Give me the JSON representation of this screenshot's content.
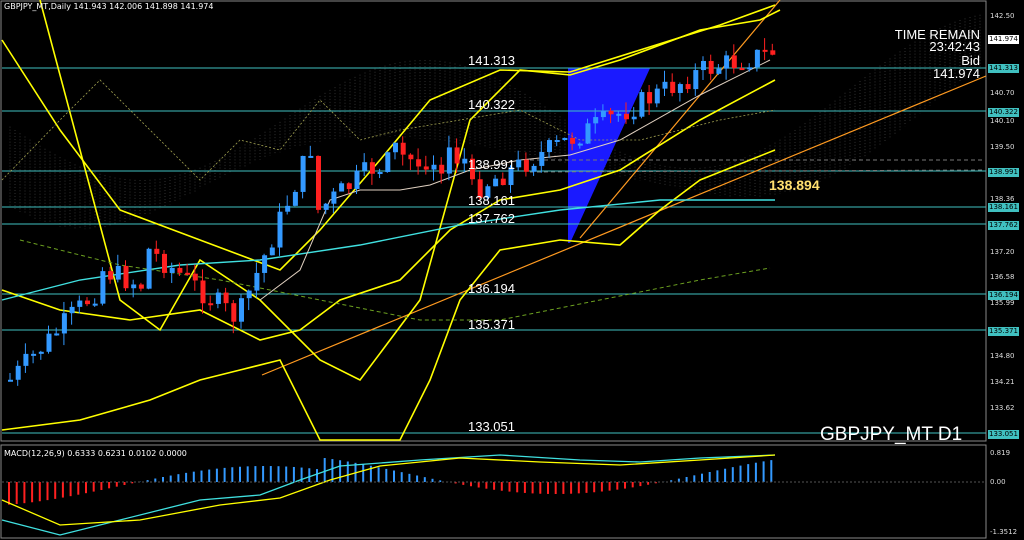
{
  "header": {
    "title": "GBPJPY_MT,Daily  141.943 142.006 141.898 141.974"
  },
  "info": {
    "time_remain_label": "TIME REMAIN",
    "time_remain_value": "23:42:43",
    "bid_label": "Bid",
    "bid_value": "141.974"
  },
  "symbol_label": "GBPJPY_MT D1",
  "level_labels": [
    "141.313",
    "140.322",
    "138.991",
    "138.161",
    "137.762",
    "136.194",
    "135.371",
    "133.051"
  ],
  "highlight_level": "138.894",
  "price_axis": {
    "ticks": [
      "142.50",
      "141.91",
      "140.70",
      "140.10",
      "139.50",
      "138.90",
      "138.36",
      "137.76",
      "137.20",
      "136.58",
      "135.99",
      "135.40",
      "134.80",
      "134.21",
      "133.62",
      "133.02"
    ],
    "boxes": [
      {
        "label": "141.974",
        "color": "#ffffff",
        "bg": "#ffffff",
        "fg": "#000000"
      },
      {
        "label": "141.313",
        "color": "#40c0c0",
        "bg": "#40c0c0",
        "fg": "#000000"
      },
      {
        "label": "140.322",
        "color": "#40c0c0",
        "bg": "#40c0c0",
        "fg": "#000000"
      },
      {
        "label": "138.991",
        "color": "#40c0c0",
        "bg": "#40c0c0",
        "fg": "#000000"
      },
      {
        "label": "138.161",
        "color": "#40c0c0",
        "bg": "#40c0c0",
        "fg": "#000000"
      },
      {
        "label": "137.762",
        "color": "#40c0c0",
        "bg": "#40c0c0",
        "fg": "#000000"
      },
      {
        "label": "136.194",
        "color": "#40c0c0",
        "bg": "#40c0c0",
        "fg": "#000000"
      },
      {
        "label": "135.371",
        "color": "#40c0c0",
        "bg": "#40c0c0",
        "fg": "#000000"
      },
      {
        "label": "133.051",
        "color": "#40c0c0",
        "bg": "#40c0c0",
        "fg": "#000000"
      }
    ]
  },
  "macd": {
    "header": "MACD(12,26,9)  0.6333  0.6231  0.0102  0.0000",
    "ticks": [
      "0.819",
      "0.00",
      "-1.3512"
    ]
  },
  "colors": {
    "bull": "#3399ff",
    "bear": "#ff2020",
    "level": "#40c0c0",
    "band": "#ffff00",
    "trend": "#ff9a20",
    "triangle": "#1a1aff"
  }
}
